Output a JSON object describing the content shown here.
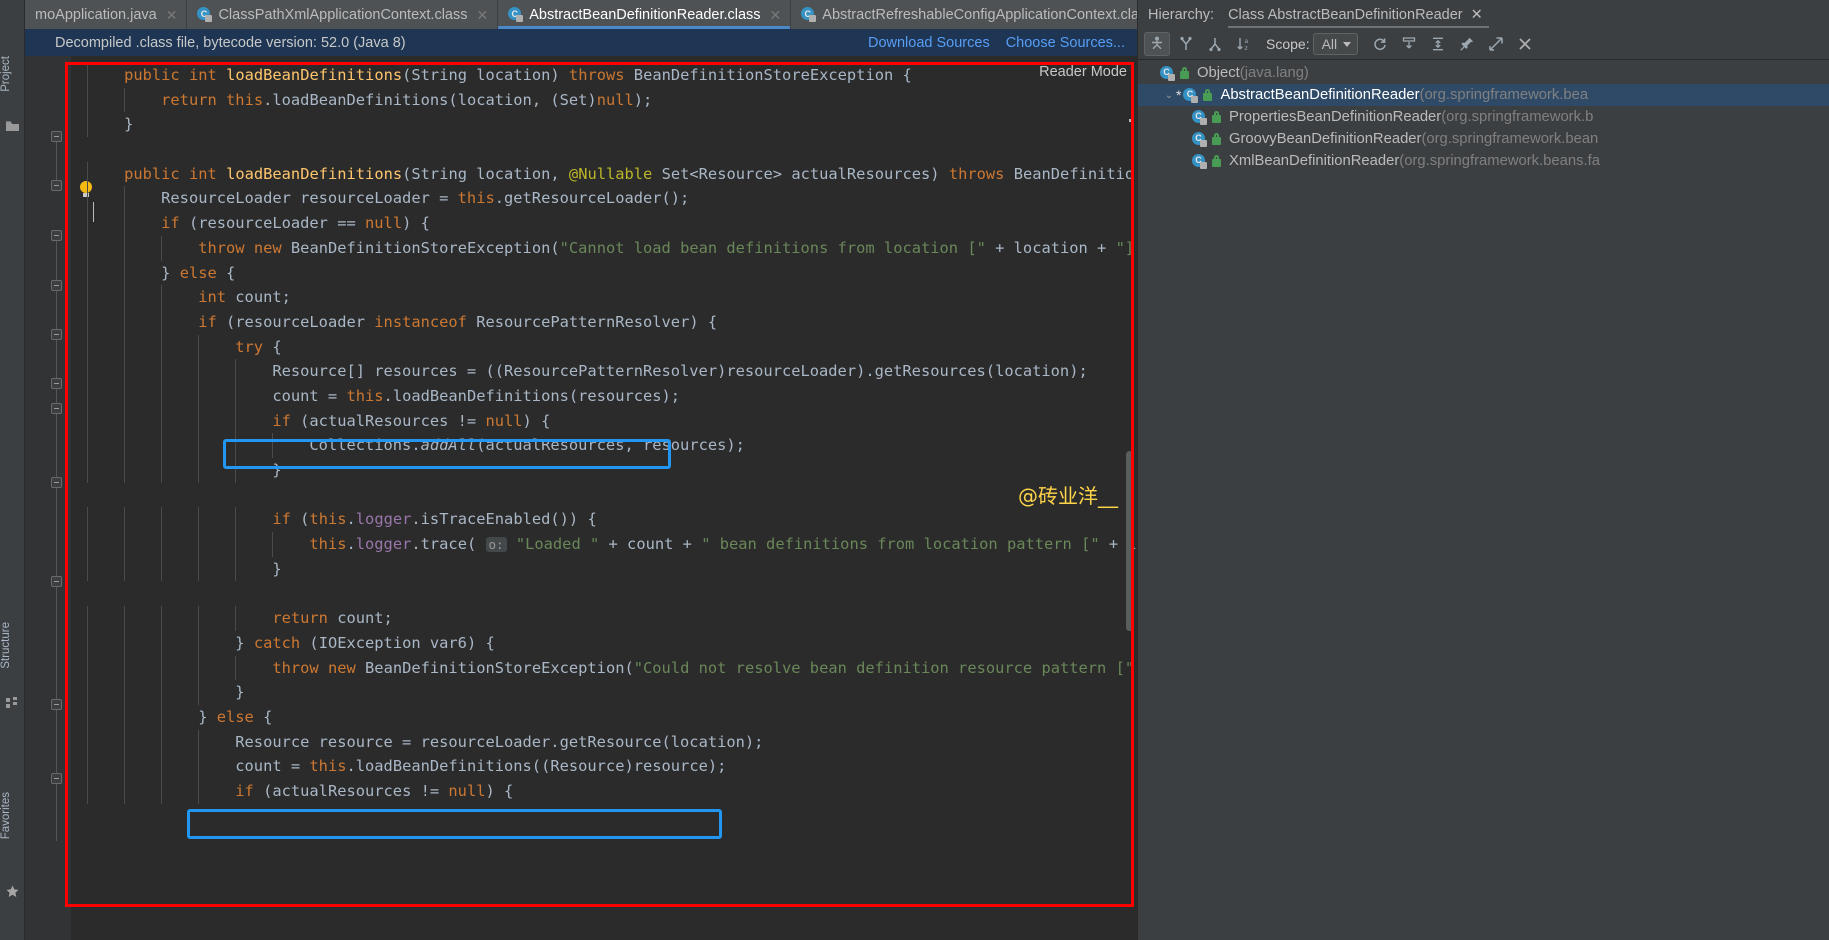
{
  "window": {
    "theme_bg": "#3c3f41",
    "editor_bg": "#2b2b2b",
    "accent": "#4a88c7",
    "highlight_blue": "#2196f3",
    "highlight_red": "#ff0000"
  },
  "left_strip": {
    "items": [
      {
        "label": "Project",
        "icon": "folder-icon"
      },
      {
        "label": "Structure",
        "icon": "structure-icon"
      },
      {
        "label": "Favorites",
        "icon": "star-icon"
      }
    ]
  },
  "editor": {
    "tabs": [
      {
        "label": "moApplication.java",
        "icon": "java-file-icon",
        "active": false,
        "truncated_left": true
      },
      {
        "label": "ClassPathXmlApplicationContext.class",
        "icon": "class-file-icon",
        "active": false
      },
      {
        "label": "AbstractBeanDefinitionReader.class",
        "icon": "class-file-icon",
        "active": true
      },
      {
        "label": "AbstractRefreshableConfigApplicationContext.class",
        "icon": "class-file-icon",
        "active": false
      }
    ],
    "tab_overflow_icon": "chevron-down-icon",
    "notification": {
      "message": "Decompiled .class file, bytecode version: 52.0 (Java 8)",
      "actions": [
        "Download Sources",
        "Choose Sources..."
      ]
    },
    "reader_mode_label": "Reader Mode",
    "watermark": "@砖业洋__",
    "lines": [
      {
        "indent": 4,
        "tokens": [
          {
            "t": "public",
            "c": "kw"
          },
          {
            "t": " ",
            "c": "plain"
          },
          {
            "t": "int",
            "c": "kw"
          },
          {
            "t": " ",
            "c": "plain"
          },
          {
            "t": "loadBeanDefinitions",
            "c": "mth"
          },
          {
            "t": "(String location) ",
            "c": "plain"
          },
          {
            "t": "throws",
            "c": "kw"
          },
          {
            "t": " BeanDefinitionStoreException {",
            "c": "plain"
          }
        ]
      },
      {
        "indent": 8,
        "tokens": [
          {
            "t": "return",
            "c": "kw"
          },
          {
            "t": " ",
            "c": "plain"
          },
          {
            "t": "this",
            "c": "kw"
          },
          {
            "t": ".loadBeanDefinitions(location, (Set)",
            "c": "plain"
          },
          {
            "t": "null",
            "c": "kw"
          },
          {
            "t": ");",
            "c": "plain"
          }
        ]
      },
      {
        "indent": 4,
        "tokens": [
          {
            "t": "}",
            "c": "plain"
          }
        ]
      },
      {
        "indent": 0,
        "tokens": []
      },
      {
        "indent": 4,
        "tokens": [
          {
            "t": "public",
            "c": "kw"
          },
          {
            "t": " ",
            "c": "plain"
          },
          {
            "t": "int",
            "c": "kw"
          },
          {
            "t": " ",
            "c": "plain"
          },
          {
            "t": "loadBeanDefinitions",
            "c": "mth"
          },
          {
            "t": "(String location, ",
            "c": "plain"
          },
          {
            "t": "@Nullable",
            "c": "ann"
          },
          {
            "t": " Set<Resource> actualResources) ",
            "c": "plain"
          },
          {
            "t": "throws",
            "c": "kw"
          },
          {
            "t": " BeanDefinitio",
            "c": "plain"
          }
        ]
      },
      {
        "indent": 8,
        "tokens": [
          {
            "t": "ResourceLoader resourceLoader = ",
            "c": "plain"
          },
          {
            "t": "this",
            "c": "kw"
          },
          {
            "t": ".getResourceLoader();",
            "c": "plain"
          }
        ]
      },
      {
        "indent": 8,
        "tokens": [
          {
            "t": "if",
            "c": "kw"
          },
          {
            "t": " (resourceLoader == ",
            "c": "plain"
          },
          {
            "t": "null",
            "c": "kw"
          },
          {
            "t": ") {",
            "c": "plain"
          }
        ]
      },
      {
        "indent": 12,
        "tokens": [
          {
            "t": "throw",
            "c": "kw"
          },
          {
            "t": " ",
            "c": "plain"
          },
          {
            "t": "new",
            "c": "kw"
          },
          {
            "t": " BeanDefinitionStoreException(",
            "c": "plain"
          },
          {
            "t": "\"Cannot load bean definitions from location [\"",
            "c": "str"
          },
          {
            "t": " + location + ",
            "c": "plain"
          },
          {
            "t": "\"]",
            "c": "str"
          }
        ]
      },
      {
        "indent": 8,
        "tokens": [
          {
            "t": "} ",
            "c": "plain"
          },
          {
            "t": "else",
            "c": "kw"
          },
          {
            "t": " {",
            "c": "plain"
          }
        ]
      },
      {
        "indent": 12,
        "tokens": [
          {
            "t": "int",
            "c": "kw"
          },
          {
            "t": " count;",
            "c": "plain"
          }
        ]
      },
      {
        "indent": 12,
        "tokens": [
          {
            "t": "if",
            "c": "kw"
          },
          {
            "t": " (resourceLoader ",
            "c": "plain"
          },
          {
            "t": "instanceof",
            "c": "kw"
          },
          {
            "t": " ResourcePatternResolver) {",
            "c": "plain"
          }
        ]
      },
      {
        "indent": 16,
        "tokens": [
          {
            "t": "try",
            "c": "kw"
          },
          {
            "t": " {",
            "c": "plain"
          }
        ]
      },
      {
        "indent": 20,
        "tokens": [
          {
            "t": "Resource[] resources = ((ResourcePatternResolver)resourceLoader).getResources(location);",
            "c": "plain"
          }
        ]
      },
      {
        "indent": 20,
        "tokens": [
          {
            "t": "count = ",
            "c": "plain"
          },
          {
            "t": "this",
            "c": "kw"
          },
          {
            "t": ".loadBeanDefinitions(resources);",
            "c": "plain"
          }
        ]
      },
      {
        "indent": 20,
        "tokens": [
          {
            "t": "if",
            "c": "kw"
          },
          {
            "t": " (actualResources != ",
            "c": "plain"
          },
          {
            "t": "null",
            "c": "kw"
          },
          {
            "t": ") {",
            "c": "plain"
          }
        ]
      },
      {
        "indent": 24,
        "tokens": [
          {
            "t": "Collections.",
            "c": "plain"
          },
          {
            "t": "addAll",
            "c": "plain ital"
          },
          {
            "t": "(actualResources, resources);",
            "c": "plain"
          }
        ]
      },
      {
        "indent": 20,
        "tokens": [
          {
            "t": "}",
            "c": "plain"
          }
        ]
      },
      {
        "indent": 0,
        "tokens": []
      },
      {
        "indent": 20,
        "tokens": [
          {
            "t": "if",
            "c": "kw"
          },
          {
            "t": " (",
            "c": "plain"
          },
          {
            "t": "this",
            "c": "kw"
          },
          {
            "t": ".",
            "c": "plain"
          },
          {
            "t": "logger",
            "c": "fld"
          },
          {
            "t": ".isTraceEnabled()) {",
            "c": "plain"
          }
        ]
      },
      {
        "indent": 24,
        "tokens": [
          {
            "t": "this",
            "c": "kw"
          },
          {
            "t": ".",
            "c": "plain"
          },
          {
            "t": "logger",
            "c": "fld"
          },
          {
            "t": ".trace( ",
            "c": "plain"
          },
          {
            "t": "o:",
            "c": "hint"
          },
          {
            "t": " ",
            "c": "plain"
          },
          {
            "t": "\"Loaded \"",
            "c": "str"
          },
          {
            "t": " + count + ",
            "c": "plain"
          },
          {
            "t": "\" bean definitions from location pattern [\"",
            "c": "str"
          },
          {
            "t": " + lo",
            "c": "plain"
          }
        ]
      },
      {
        "indent": 20,
        "tokens": [
          {
            "t": "}",
            "c": "plain"
          }
        ]
      },
      {
        "indent": 0,
        "tokens": []
      },
      {
        "indent": 20,
        "tokens": [
          {
            "t": "return",
            "c": "kw"
          },
          {
            "t": " count;",
            "c": "plain"
          }
        ]
      },
      {
        "indent": 16,
        "tokens": [
          {
            "t": "} ",
            "c": "plain"
          },
          {
            "t": "catch",
            "c": "kw"
          },
          {
            "t": " (IOException var6) {",
            "c": "plain"
          }
        ]
      },
      {
        "indent": 20,
        "tokens": [
          {
            "t": "throw",
            "c": "kw"
          },
          {
            "t": " ",
            "c": "plain"
          },
          {
            "t": "new",
            "c": "kw"
          },
          {
            "t": " BeanDefinitionStoreException(",
            "c": "plain"
          },
          {
            "t": "\"Could not resolve bean definition resource pattern [\"",
            "c": "str"
          }
        ]
      },
      {
        "indent": 16,
        "tokens": [
          {
            "t": "}",
            "c": "plain"
          }
        ]
      },
      {
        "indent": 12,
        "tokens": [
          {
            "t": "} ",
            "c": "plain"
          },
          {
            "t": "else",
            "c": "kw"
          },
          {
            "t": " {",
            "c": "plain"
          }
        ]
      },
      {
        "indent": 16,
        "tokens": [
          {
            "t": "Resource resource = resourceLoader.getResource(location);",
            "c": "plain"
          }
        ]
      },
      {
        "indent": 16,
        "tokens": [
          {
            "t": "count = ",
            "c": "plain"
          },
          {
            "t": "this",
            "c": "kw"
          },
          {
            "t": ".loadBeanDefinitions((Resource)resource);",
            "c": "plain"
          }
        ]
      },
      {
        "indent": 16,
        "tokens": [
          {
            "t": "if",
            "c": "kw"
          },
          {
            "t": " (actualResources != ",
            "c": "plain"
          },
          {
            "t": "null",
            "c": "kw"
          },
          {
            "t": ") {",
            "c": "plain"
          }
        ]
      }
    ]
  },
  "hierarchy": {
    "panel_label": "Hierarchy:",
    "tab_label": "Class AbstractBeanDefinitionReader",
    "tab_close_icon": "close-icon",
    "toolbar": {
      "buttons": [
        {
          "name": "type-hierarchy-icon",
          "selected": true
        },
        {
          "name": "supertypes-hierarchy-icon",
          "selected": false
        },
        {
          "name": "subtypes-hierarchy-icon",
          "selected": false
        },
        {
          "name": "sort-alphabetically-icon",
          "selected": false
        }
      ],
      "scope_label": "Scope:",
      "scope_value": "All",
      "right_buttons": [
        {
          "name": "refresh-icon"
        },
        {
          "name": "expand-all-icon"
        },
        {
          "name": "collapse-all-icon"
        },
        {
          "name": "pin-icon"
        },
        {
          "name": "open-in-new-window-icon"
        },
        {
          "name": "close-icon"
        }
      ]
    },
    "tree": [
      {
        "name": "Object",
        "pkg": "(java.lang)",
        "depth": 0,
        "selected": false,
        "arrow": "",
        "star": false
      },
      {
        "name": "AbstractBeanDefinitionReader",
        "pkg": "(org.springframework.bea",
        "depth": 1,
        "selected": true,
        "arrow": "v",
        "star": true
      },
      {
        "name": "PropertiesBeanDefinitionReader",
        "pkg": "(org.springframework.b",
        "depth": 2,
        "selected": false,
        "arrow": "",
        "star": false
      },
      {
        "name": "GroovyBeanDefinitionReader",
        "pkg": "(org.springframework.bean",
        "depth": 2,
        "selected": false,
        "arrow": "",
        "star": false
      },
      {
        "name": "XmlBeanDefinitionReader",
        "pkg": "(org.springframework.beans.fa",
        "depth": 2,
        "selected": false,
        "arrow": "",
        "star": false
      }
    ]
  }
}
